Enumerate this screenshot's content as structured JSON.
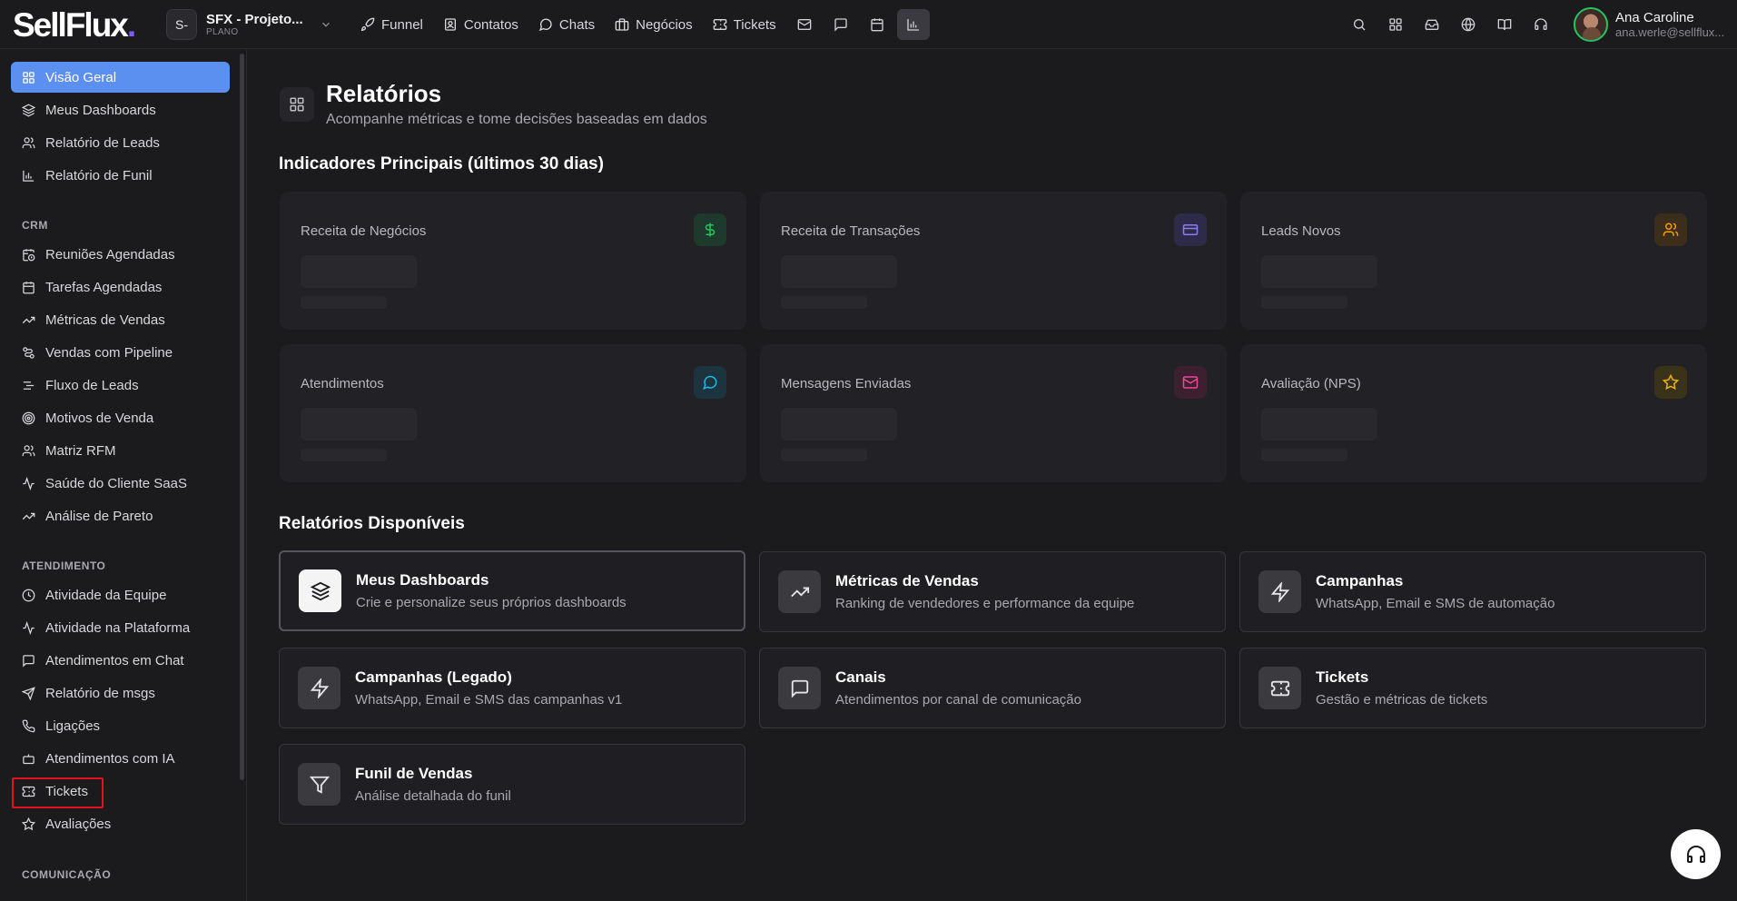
{
  "brand": {
    "name": "SellFlux",
    "dot": "."
  },
  "project": {
    "avatar": "S-",
    "name": "SFX - Projeto...",
    "plan": "PLANO"
  },
  "nav": [
    {
      "label": "Funnel",
      "icon": "rocket-icon"
    },
    {
      "label": "Contatos",
      "icon": "contacts-icon"
    },
    {
      "label": "Chats",
      "icon": "chat-icon"
    },
    {
      "label": "Negócios",
      "icon": "briefcase-icon"
    },
    {
      "label": "Tickets",
      "icon": "ticket-icon"
    }
  ],
  "nav_icons": [
    "mail-icon",
    "message-square-icon",
    "calendar-icon",
    "bar-chart-icon"
  ],
  "right_icons": [
    "search-icon",
    "apps-grid-icon",
    "inbox-icon",
    "globe-icon",
    "book-icon",
    "headset-icon"
  ],
  "user": {
    "name": "Ana Caroline",
    "email": "ana.werle@sellflux..."
  },
  "sidebar": {
    "top": [
      {
        "label": "Visão Geral",
        "icon": "grid-icon",
        "active": true
      },
      {
        "label": "Meus Dashboards",
        "icon": "layers-icon"
      },
      {
        "label": "Relatório de Leads",
        "icon": "users-icon"
      },
      {
        "label": "Relatório de Funil",
        "icon": "bar-chart-icon"
      }
    ],
    "crm_title": "CRM",
    "crm": [
      {
        "label": "Reuniões Agendadas",
        "icon": "calendar-clock-icon"
      },
      {
        "label": "Tarefas Agendadas",
        "icon": "calendar-icon"
      },
      {
        "label": "Métricas de Vendas",
        "icon": "trending-up-icon"
      },
      {
        "label": "Vendas com Pipeline",
        "icon": "pipeline-icon"
      },
      {
        "label": "Fluxo de Leads",
        "icon": "list-flow-icon"
      },
      {
        "label": "Motivos de Venda",
        "icon": "target-icon"
      },
      {
        "label": "Matriz RFM",
        "icon": "users-icon"
      },
      {
        "label": "Saúde do Cliente SaaS",
        "icon": "activity-icon"
      },
      {
        "label": "Análise de Pareto",
        "icon": "trending-up-icon"
      }
    ],
    "atendimento_title": "ATENDIMENTO",
    "atendimento": [
      {
        "label": "Atividade da Equipe",
        "icon": "clock-icon"
      },
      {
        "label": "Atividade na Plataforma",
        "icon": "activity-icon"
      },
      {
        "label": "Atendimentos em Chat",
        "icon": "message-square-icon"
      },
      {
        "label": "Relatório de msgs",
        "icon": "send-icon"
      },
      {
        "label": "Ligações",
        "icon": "phone-icon"
      },
      {
        "label": "Atendimentos com IA",
        "icon": "bot-icon"
      },
      {
        "label": "Tickets",
        "icon": "ticket-icon"
      },
      {
        "label": "Avaliações",
        "icon": "star-icon"
      }
    ],
    "comunicacao_title": "COMUNICAÇÃO"
  },
  "page": {
    "title": "Relatórios",
    "subtitle": "Acompanhe métricas e tome decisões baseadas em dados",
    "kpi_title": "Indicadores Principais (últimos 30 dias)",
    "reports_title": "Relatórios Disponíveis"
  },
  "kpis": [
    {
      "label": "Receita de Negócios",
      "icon": "dollar-icon",
      "color": "#22c55e",
      "bg": "#1d3a2c"
    },
    {
      "label": "Receita de Transações",
      "icon": "credit-card-icon",
      "color": "#8b7cf6",
      "bg": "#2d2a4a"
    },
    {
      "label": "Leads Novos",
      "icon": "users-icon",
      "color": "#f59e0b",
      "bg": "#3d2e1c"
    },
    {
      "label": "Atendimentos",
      "icon": "chat-bubble-icon",
      "color": "#22b8e6",
      "bg": "#1c3440"
    },
    {
      "label": "Mensagens Enviadas",
      "icon": "mail-icon",
      "color": "#ec4899",
      "bg": "#3d2030"
    },
    {
      "label": "Avaliação (NPS)",
      "icon": "star-icon",
      "color": "#eab308",
      "bg": "#3a331a"
    }
  ],
  "reports": [
    {
      "title": "Meus Dashboards",
      "desc": "Crie e personalize seus próprios dashboards",
      "icon": "layers-icon",
      "selected": true
    },
    {
      "title": "Métricas de Vendas",
      "desc": "Ranking de vendedores e performance da equipe",
      "icon": "trending-up-icon"
    },
    {
      "title": "Campanhas",
      "desc": "WhatsApp, Email e SMS de automação",
      "icon": "zap-icon"
    },
    {
      "title": "Campanhas (Legado)",
      "desc": "WhatsApp, Email e SMS das campanhas v1",
      "icon": "zap-icon"
    },
    {
      "title": "Canais",
      "desc": "Atendimentos por canal de comunicação",
      "icon": "message-square-icon"
    },
    {
      "title": "Tickets",
      "desc": "Gestão e métricas de tickets",
      "icon": "ticket-icon"
    },
    {
      "title": "Funil de Vendas",
      "desc": "Análise detalhada do funil",
      "icon": "filter-icon"
    }
  ]
}
